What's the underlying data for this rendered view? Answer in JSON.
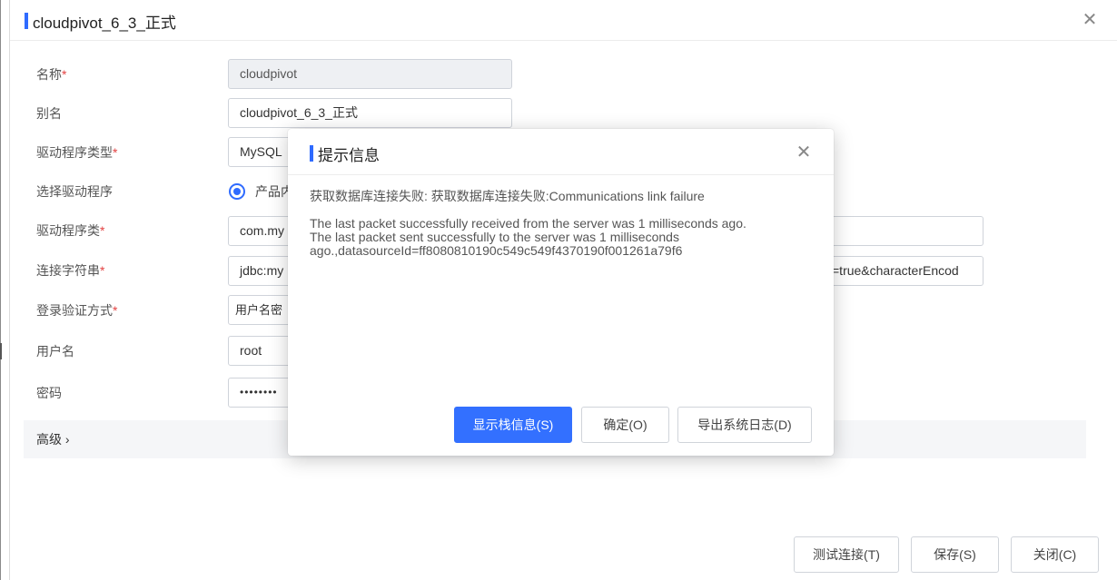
{
  "window": {
    "title": "cloudpivot_6_3_正式",
    "close_symbol": "✕"
  },
  "form": {
    "name": {
      "label": "名称",
      "required_mark": "*",
      "value": "cloudpivot"
    },
    "alias": {
      "label": "别名",
      "value": "cloudpivot_6_3_正式"
    },
    "driver_type": {
      "label": "驱动程序类型",
      "required_mark": "*",
      "value": "MySQL"
    },
    "driver_select": {
      "label": "选择驱动程序",
      "option": "产品内"
    },
    "driver_class": {
      "label": "驱动程序类",
      "required_mark": "*",
      "value": "com.my"
    },
    "conn_string": {
      "label": "连接字符串",
      "required_mark": "*",
      "value": "jdbc:my",
      "value_tail": "=true&characterEncod"
    },
    "auth": {
      "label": "登录验证方式",
      "required_mark": "*",
      "value": "用户名密"
    },
    "username": {
      "label": "用户名",
      "value": "root"
    },
    "password": {
      "label": "密码",
      "value": "••••••••"
    },
    "advanced": {
      "label": "高级 ›"
    }
  },
  "footer": {
    "test_label": "测试连接(T)",
    "save_label": "保存(S)",
    "close_label": "关闭(C)"
  },
  "dialog": {
    "title": "提示信息",
    "close_symbol": "✕",
    "message_line1": "获取数据库连接失败: 获取数据库连接失败:Communications link failure",
    "message_line2": "The last packet successfully received from the server was 1 milliseconds ago.",
    "message_line3": "The last packet sent successfully to the server was 1 milliseconds",
    "message_line4": "ago.,datasourceId=ff8080810190c549c549f4370190f001261a79f6",
    "show_stack_label": "显示栈信息(S)",
    "ok_label": "确定(O)",
    "export_log_label": "导出系统日志(D)"
  },
  "colors": {
    "accent": "#3370ff",
    "required": "#e34242"
  }
}
